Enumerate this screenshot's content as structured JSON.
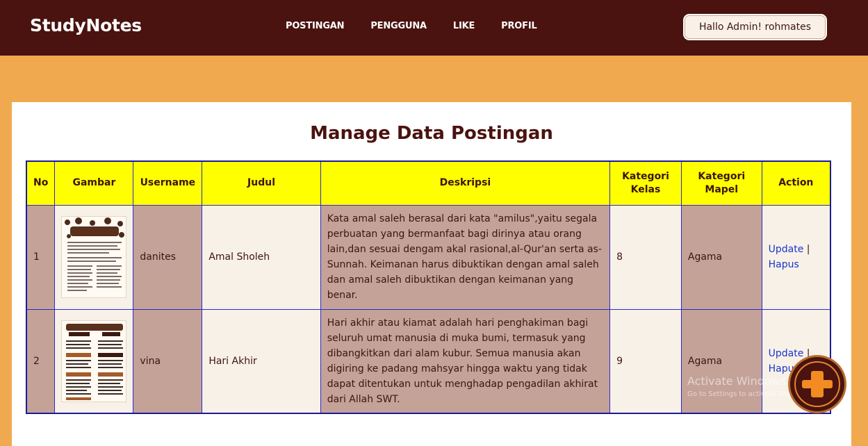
{
  "app": {
    "brand": "StudyNotes"
  },
  "nav": {
    "items": [
      {
        "label": "POSTINGAN"
      },
      {
        "label": "PENGGUNA"
      },
      {
        "label": "LIKE"
      },
      {
        "label": "PROFIL"
      }
    ],
    "greeting": "Hallo Admin! rohmates"
  },
  "page": {
    "title": "Manage Data Postingan"
  },
  "table": {
    "headers": {
      "no": "No",
      "gambar": "Gambar",
      "username": "Username",
      "judul": "Judul",
      "deskripsi": "Deskripsi",
      "kategori_kelas": "Kategori Kelas",
      "kategori_mapel": "Kategori Mapel",
      "action": "Action"
    },
    "rows": [
      {
        "no": "1",
        "username": "danites",
        "judul": "Amal Sholeh",
        "deskripsi": "Kata amal saleh berasal dari kata \"amilus\",yaitu segala perbuatan yang bermanfaat bagi dirinya atau orang lain,dan sesuai dengam akal rasional,al-Qur'an serta as-Sunnah. Keimanan harus dibuktikan dengan amal saleh dan amal saleh dibuktikan dengan keimanan yang benar.",
        "kategori_kelas": "8",
        "kategori_mapel": "Agama",
        "update": "Update",
        "sep": " |",
        "hapus": "Hapus"
      },
      {
        "no": "2",
        "username": "vina",
        "judul": "Hari Akhir",
        "deskripsi": "Hari akhir atau kiamat adalah hari penghakiman bagi seluruh umat manusia di muka bumi, termasuk yang dibangkitkan dari alam kubur. Semua manusia akan digiring ke padang mahsyar hingga waktu yang tidak dapat ditentukan untuk menghadap pengadilan akhirat dari Allah SWT.",
        "kategori_kelas": "9",
        "kategori_mapel": "Agama",
        "update": "Update",
        "sep": " |",
        "hapus": "Hapus"
      }
    ]
  },
  "watermark": {
    "line1": "Activate Windows",
    "line2": "Go to Settings to activate Windows."
  },
  "fab": {
    "icon": "plus-icon"
  },
  "colors": {
    "navbar": "#4a130f",
    "background": "#f0a94f",
    "header_row": "#ffff00",
    "tan_cell": "#c4a298",
    "cream_cell": "#f8f1e8",
    "link": "#1a35c9"
  }
}
